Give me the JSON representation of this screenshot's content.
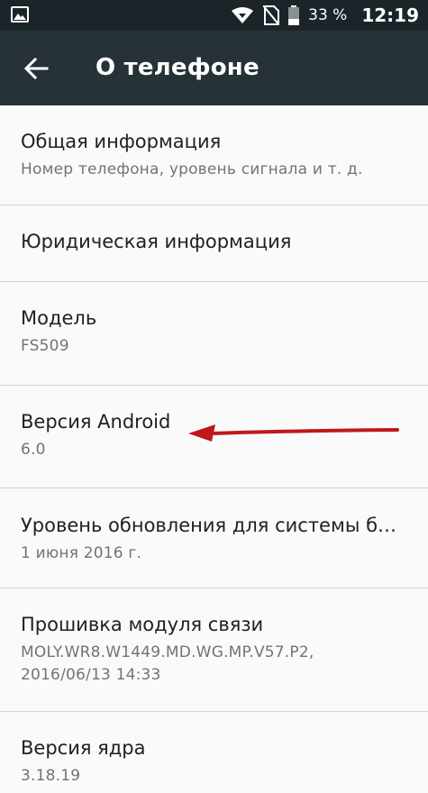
{
  "status_bar": {
    "battery_pct": "33 %",
    "clock": "12:19",
    "icons": [
      "gallery-icon",
      "wifi-icon",
      "no-sim-icon",
      "battery-icon"
    ]
  },
  "app_bar": {
    "title": "О телефоне"
  },
  "items": [
    {
      "title": "Общая информация",
      "subtitle": "Номер телефона, уровень сигнала и т. д."
    },
    {
      "title": "Юридическая информация"
    },
    {
      "title": "Модель",
      "subtitle": "FS509"
    },
    {
      "title": "Версия Android",
      "subtitle": "6.0"
    },
    {
      "title": "Уровень обновления для системы б…",
      "subtitle": "1 июня 2016 г."
    },
    {
      "title": "Прошивка модуля связи",
      "subtitle": "MOLY.WR8.W1449.MD.WG.MP.V57.P2,",
      "subtitle2": "2016/06/13 14:33"
    },
    {
      "title": "Версия ядра",
      "subtitle": "3.18.19"
    }
  ],
  "colors": {
    "status_bar": "#1b2529",
    "app_bar": "#263238",
    "background": "#fafafa",
    "arrow": "#c0181b"
  }
}
